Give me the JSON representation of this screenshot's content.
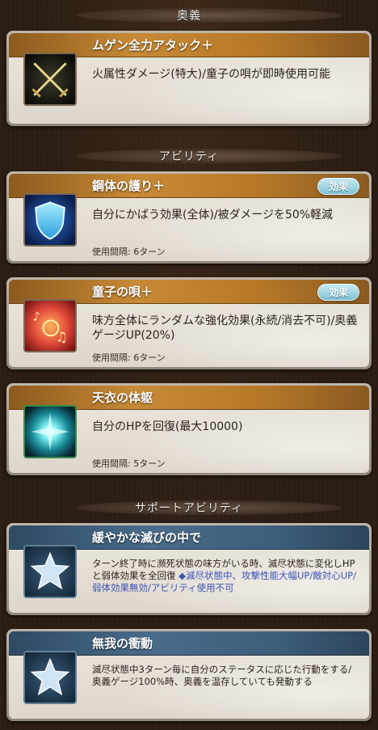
{
  "sections": {
    "ougi": "奥義",
    "abilities": "アビリティ",
    "support": "サポートアビリティ"
  },
  "ougi": {
    "name": "ムゲン全力アタック＋",
    "description": "火属性ダメージ(特大)/童子の唄が即時使用可能",
    "icon": "crossed-swords-icon"
  },
  "abilities": [
    {
      "name": "鋼体の護り＋",
      "badge": "効果",
      "description": "自分にかばう効果(全体)/被ダメージを50%軽減",
      "cooldown": "使用間隔: 6ターン",
      "icon": "shield-icon"
    },
    {
      "name": "童子の唄＋",
      "badge": "効果",
      "description": "味方全体にランダムな強化効果(永続/消去不可)/奥義ゲージUP(20%)",
      "cooldown": "使用間隔: 6ターン",
      "icon": "music-icon"
    },
    {
      "name": "天衣の体躯",
      "description": "自分のHPを回復(最大10000)",
      "cooldown": "使用間隔: 5ターン",
      "icon": "heal-burst-icon"
    }
  ],
  "support": [
    {
      "name": "緩やかな滅びの中で",
      "description": "ターン終了時に瀕死状態の味方がいる時、滅尽状態に変化しHPと弱体効果を全回復",
      "note": "◆滅尽状態中、攻撃性能大幅UP/敵対心UP/弱体効果無効/アビリティ使用不可",
      "icon": "star-icon"
    },
    {
      "name": "無我の衝動",
      "description": "滅尽状態中3ターン毎に自分のステータスに応じた行動をする/奥義ゲージ100%時、奥義を温存していても発動する",
      "icon": "star-icon"
    }
  ],
  "colors": {
    "title_gold": "#c88a36",
    "title_blue": "#4a6c8a",
    "badge": "#7fc2d4",
    "note_blue": "#3b52b8"
  }
}
